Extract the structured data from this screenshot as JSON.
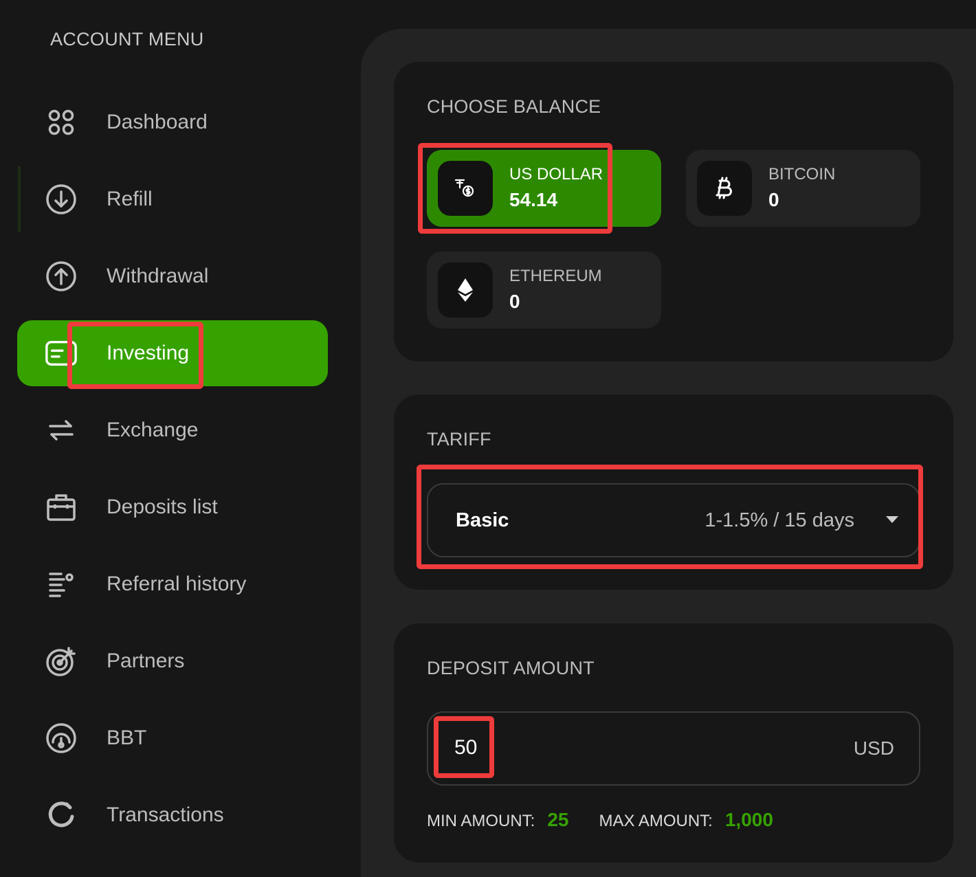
{
  "sidebar": {
    "title": "ACCOUNT MENU",
    "items": [
      {
        "label": "Dashboard",
        "icon": "grid-icon"
      },
      {
        "label": "Refill",
        "icon": "arrow-down-circle-icon"
      },
      {
        "label": "Withdrawal",
        "icon": "arrow-up-circle-icon"
      },
      {
        "label": "Investing",
        "icon": "card-icon",
        "active": true
      },
      {
        "label": "Exchange",
        "icon": "swap-arrows-icon"
      },
      {
        "label": "Deposits list",
        "icon": "briefcase-icon"
      },
      {
        "label": "Referral history",
        "icon": "list-icon"
      },
      {
        "label": "Partners",
        "icon": "target-icon"
      },
      {
        "label": "BBT",
        "icon": "gauge-icon"
      },
      {
        "label": "Transactions",
        "icon": "refresh-icon"
      }
    ]
  },
  "balance": {
    "title": "CHOOSE BALANCE",
    "options": [
      {
        "name": "US DOLLAR",
        "value": "54.14",
        "icon": "tether-icon",
        "selected": true
      },
      {
        "name": "BITCOIN",
        "value": "0",
        "icon": "bitcoin-icon"
      },
      {
        "name": "ETHEREUM",
        "value": "0",
        "icon": "ethereum-icon"
      }
    ]
  },
  "tariff": {
    "title": "TARIFF",
    "selected_name": "Basic",
    "selected_rate": "1-1.5% / 15 days"
  },
  "deposit": {
    "title": "DEPOSIT AMOUNT",
    "value": "50",
    "currency": "USD",
    "min_label": "MIN AMOUNT:",
    "min_value": "25",
    "max_label": "MAX AMOUNT:",
    "max_value": "1,000"
  },
  "colors": {
    "accent": "#36a200",
    "selected_balance": "#2d8a00",
    "background": "#171717",
    "panel": "#232323",
    "highlight": "#ee3b3b"
  }
}
